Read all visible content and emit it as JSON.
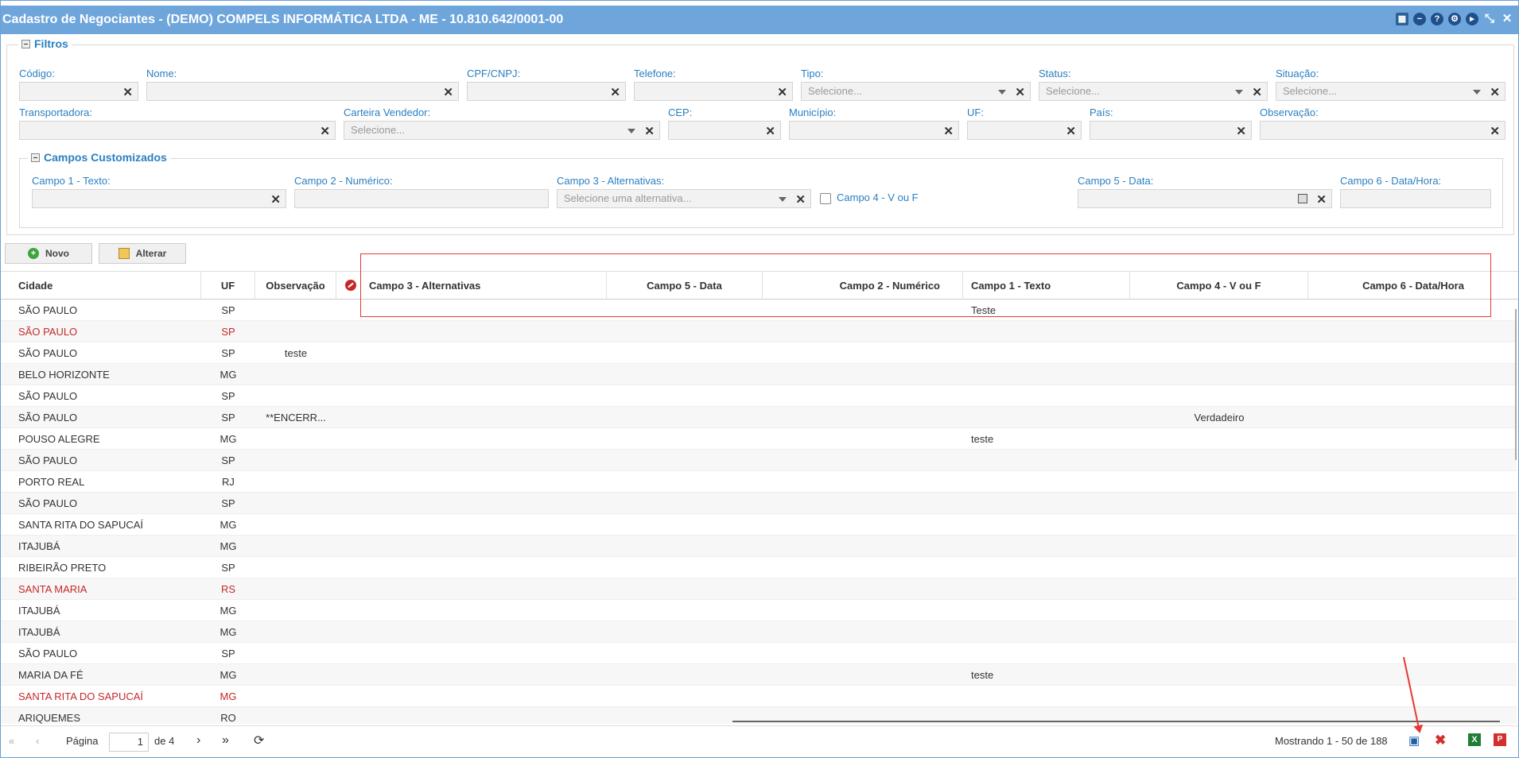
{
  "window": {
    "title": "Cadastro de Negociantes - (DEMO) COMPELS INFORMÁTICA LTDA - ME - 10.810.642/0001-00"
  },
  "filters": {
    "legend": "Filtros",
    "codigo": "Código:",
    "nome": "Nome:",
    "cpf": "CPF/CNPJ:",
    "telefone": "Telefone:",
    "tipo": "Tipo:",
    "status": "Status:",
    "situacao": "Situação:",
    "transportadora": "Transportadora:",
    "carteira": "Carteira Vendedor:",
    "cep": "CEP:",
    "municipio": "Município:",
    "uf": "UF:",
    "pais": "País:",
    "observacao": "Observação:",
    "select_placeholder": "Selecione..."
  },
  "custom": {
    "legend": "Campos Customizados",
    "campo1": "Campo 1 - Texto:",
    "campo2": "Campo 2 - Numérico:",
    "campo3": "Campo 3 - Alternativas:",
    "campo3_placeholder": "Selecione uma alternativa...",
    "campo4": "Campo 4 - V ou F",
    "campo5": "Campo 5 - Data:",
    "campo6": "Campo 6 - Data/Hora:"
  },
  "toolbar": {
    "novo": "Novo",
    "alterar": "Alterar"
  },
  "grid": {
    "headers": {
      "cidade": "Cidade",
      "uf": "UF",
      "observacao": "Observação",
      "campo3": "Campo 3 - Alternativas",
      "campo5": "Campo 5 - Data",
      "campo2": "Campo 2 - Numérico",
      "campo1": "Campo 1 - Texto",
      "campo4": "Campo 4 - V ou F",
      "campo6": "Campo 6 - Data/Hora"
    },
    "rows": [
      {
        "cidade": "SÃO PAULO",
        "uf": "SP",
        "obs": "",
        "campo1": "Teste",
        "campo4": "",
        "red": false
      },
      {
        "cidade": "SÃO PAULO",
        "uf": "SP",
        "obs": "",
        "campo1": "",
        "campo4": "",
        "red": true
      },
      {
        "cidade": "SÃO PAULO",
        "uf": "SP",
        "obs": "teste",
        "campo1": "",
        "campo4": "",
        "red": false
      },
      {
        "cidade": "BELO HORIZONTE",
        "uf": "MG",
        "obs": "",
        "campo1": "",
        "campo4": "",
        "red": false
      },
      {
        "cidade": "SÃO PAULO",
        "uf": "SP",
        "obs": "",
        "campo1": "",
        "campo4": "",
        "red": false
      },
      {
        "cidade": "SÃO PAULO",
        "uf": "SP",
        "obs": "**ENCERR...",
        "campo1": "",
        "campo4": "Verdadeiro",
        "red": false
      },
      {
        "cidade": "POUSO ALEGRE",
        "uf": "MG",
        "obs": "",
        "campo1": "teste",
        "campo4": "",
        "red": false
      },
      {
        "cidade": "SÃO PAULO",
        "uf": "SP",
        "obs": "",
        "campo1": "",
        "campo4": "",
        "red": false
      },
      {
        "cidade": "PORTO REAL",
        "uf": "RJ",
        "obs": "",
        "campo1": "",
        "campo4": "",
        "red": false
      },
      {
        "cidade": "SÃO PAULO",
        "uf": "SP",
        "obs": "",
        "campo1": "",
        "campo4": "",
        "red": false
      },
      {
        "cidade": "SANTA RITA DO SAPUCAÍ",
        "uf": "MG",
        "obs": "",
        "campo1": "",
        "campo4": "",
        "red": false
      },
      {
        "cidade": "ITAJUBÁ",
        "uf": "MG",
        "obs": "",
        "campo1": "",
        "campo4": "",
        "red": false
      },
      {
        "cidade": "RIBEIRÃO PRETO",
        "uf": "SP",
        "obs": "",
        "campo1": "",
        "campo4": "",
        "red": false
      },
      {
        "cidade": "SANTA MARIA",
        "uf": "RS",
        "obs": "",
        "campo1": "",
        "campo4": "",
        "red": true
      },
      {
        "cidade": "ITAJUBÁ",
        "uf": "MG",
        "obs": "",
        "campo1": "",
        "campo4": "",
        "red": false
      },
      {
        "cidade": "ITAJUBÁ",
        "uf": "MG",
        "obs": "",
        "campo1": "",
        "campo4": "",
        "red": false
      },
      {
        "cidade": "SÃO PAULO",
        "uf": "SP",
        "obs": "",
        "campo1": "",
        "campo4": "",
        "red": false
      },
      {
        "cidade": "MARIA DA FÉ",
        "uf": "MG",
        "obs": "",
        "campo1": "teste",
        "campo4": "",
        "red": false
      },
      {
        "cidade": "SANTA RITA DO SAPUCAÍ",
        "uf": "MG",
        "obs": "",
        "campo1": "",
        "campo4": "",
        "red": true
      },
      {
        "cidade": "ARIQUEMES",
        "uf": "RO",
        "obs": "",
        "campo1": "",
        "campo4": "",
        "red": false
      }
    ]
  },
  "pager": {
    "pagina": "Página",
    "current": "1",
    "of": "de 4",
    "showing": "Mostrando 1 - 50 de 188"
  },
  "colors": {
    "titlebar": "#6ea6dc",
    "accent": "#2a7fc1",
    "danger": "#c62828"
  }
}
